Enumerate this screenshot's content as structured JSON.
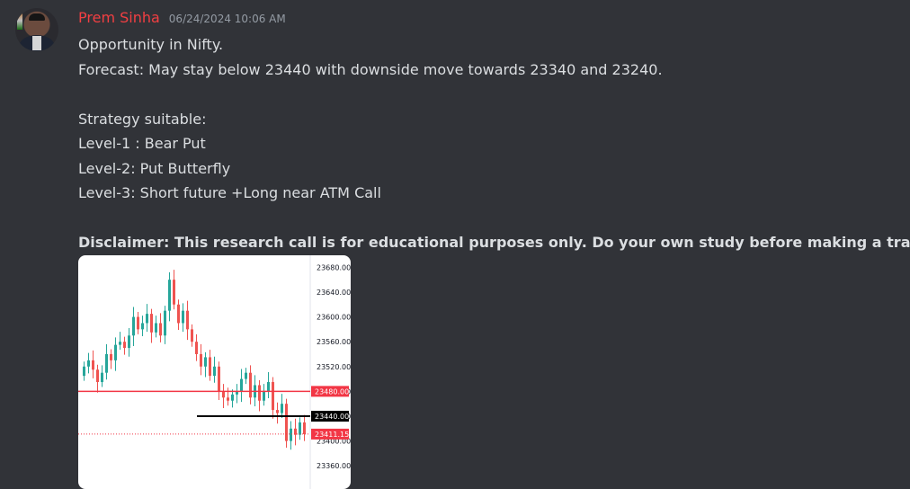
{
  "message": {
    "author": "Prem Sinha",
    "timestamp": "06/24/2024 10:06 AM",
    "lines": [
      "Opportunity in Nifty.",
      "Forecast: May stay below 23440 with downside move towards 23340 and 23240.",
      "",
      "Strategy suitable:",
      "Level-1 : Bear Put",
      "Level-2: Put Butterfly",
      "Level-3: Short future +Long near ATM Call",
      ""
    ],
    "disclaimer": "Disclaimer: This research call is for educational purposes only. Do your own study before making a trade."
  },
  "chart_data": {
    "type": "candlestick",
    "y_tick_labels": [
      "23680.00",
      "23640.00",
      "23600.00",
      "23560.00",
      "23520.00",
      "23480.00",
      "23440.00",
      "23400.00",
      "23360.00"
    ],
    "ylim": [
      23340,
      23695
    ],
    "price_lines": [
      {
        "label": "23480.00",
        "value": 23480,
        "color": "#f23645"
      },
      {
        "label": "23440.00",
        "value": 23440,
        "color": "#000000"
      },
      {
        "label": "23411.15",
        "value": 23411.15,
        "color": "#f23645"
      }
    ],
    "up_color": "#26a69a",
    "down_color": "#ef5350"
  }
}
